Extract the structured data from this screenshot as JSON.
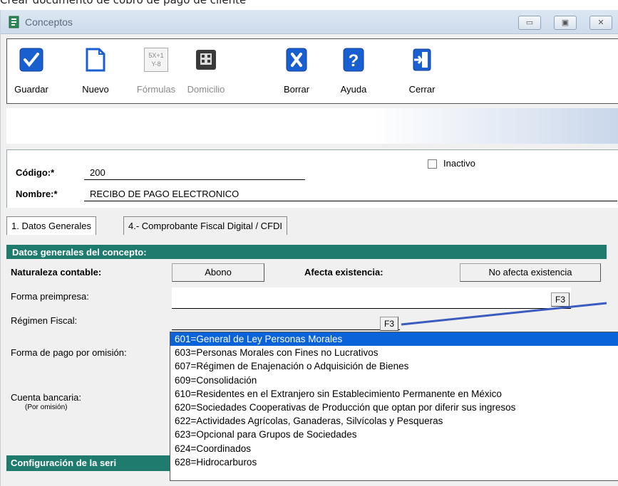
{
  "caption": "Crear documento de cobro de pago de cliente",
  "window": {
    "title": "Conceptos",
    "controls": {
      "minimize": "▭",
      "maximize": "▣",
      "close": "✕"
    }
  },
  "toolbar": {
    "guardar": "Guardar",
    "nuevo": "Nuevo",
    "formulas": "Fórmulas",
    "domicilio": "Domicilio",
    "borrar": "Borrar",
    "ayuda": "Ayuda",
    "cerrar": "Cerrar",
    "formula_icon_text_1": "5X+1",
    "formula_icon_text_2": "Y-8"
  },
  "form": {
    "codigo_label": "Código:*",
    "codigo_value": "200",
    "nombre_label": "Nombre:*",
    "nombre_value": "RECIBO DE PAGO ELECTRONICO",
    "inactivo_label": "Inactivo"
  },
  "tabs": [
    {
      "label": "1. Datos Generales",
      "active": true
    },
    {
      "label": "4.- Comprobante Fiscal Digital / CFDI",
      "active": false
    }
  ],
  "general": {
    "section_title": "Datos generales del concepto:",
    "naturaleza_label": "Naturaleza contable:",
    "naturaleza_value": "Abono",
    "afecta_label": "Afecta existencia:",
    "afecta_value": "No afecta existencia",
    "forma_preimpresa_label": "Forma preimpresa:",
    "f3": "F3",
    "regimen_label": "Régimen Fiscal:",
    "forma_pago_label": "Forma de pago por omisión:",
    "cuenta_label": "Cuenta bancaria:",
    "cuenta_sub": "(Por omisión)",
    "config_section": "Configuración de la seri"
  },
  "regimen_options": [
    "601=General de Ley Personas Morales",
    "603=Personas Morales con Fines no Lucrativos",
    "607=Régimen de Enajenación o Adquisición de Bienes",
    "609=Consolidación",
    "610=Residentes en el Extranjero sin Establecimiento Permanente en México",
    "620=Sociedades Cooperativas de Producción que optan por diferir sus ingresos",
    "622=Actividades Agrícolas, Ganaderas, Silvícolas y Pesqueras",
    "623=Opcional para Grupos de Sociedades",
    "624=Coordinados",
    "628=Hidrocarburos"
  ],
  "regimen_selected_index": 0,
  "colors": {
    "section_bar": "#1f7b6e",
    "selection": "#0a63d8",
    "arrow": "#3b5bbf",
    "icon_blue": "#1a5fd0"
  }
}
